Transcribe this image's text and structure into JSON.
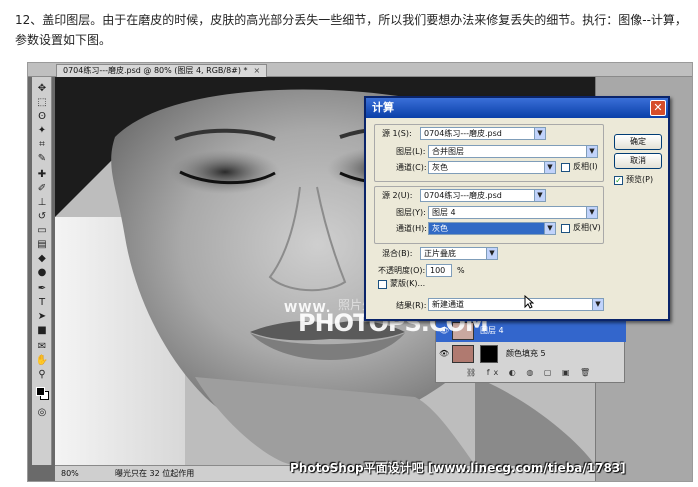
{
  "intro": {
    "text": "12、盖印图层。由于在磨皮的时候，皮肤的高光部分丢失一些细节，所以我们要想办法来修复丢失的细节。执行：图像--计算，参数设置如下图。"
  },
  "document": {
    "tab_title": "0704练习---磨皮.psd @ 80% (图层 4, RGB/8#) *",
    "tab_close": "×",
    "zoom": "80%",
    "status_info": "曝光只在 32 位起作用"
  },
  "dialog": {
    "title": "计算",
    "close": "✕",
    "source1": {
      "label": "源 1(S):",
      "file": "0704练习---磨皮.psd",
      "layer_label": "图层(L):",
      "layer": "合并图层",
      "channel_label": "通道(C):",
      "channel": "灰色",
      "invert_label": "反相(I)"
    },
    "source2": {
      "label": "源 2(U):",
      "file": "0704练习---磨皮.psd",
      "layer_label": "图层(Y):",
      "layer": "图层 4",
      "channel_label": "通道(H):",
      "channel": "灰色",
      "invert_label": "反相(V)"
    },
    "blending_label": "混合(B):",
    "blending": "正片叠底",
    "opacity_label": "不透明度(O):",
    "opacity": "100",
    "opacity_unit": "%",
    "mask_label": "蒙版(K)...",
    "result_label": "结果(R):",
    "result": "新建通道",
    "ok": "确定",
    "cancel": "取消",
    "preview_label": "预览(P)",
    "preview_checked": true
  },
  "layers": [
    {
      "name": "图层 4",
      "selected": true
    },
    {
      "name": "颜色填充 5",
      "selected": false
    }
  ],
  "watermark": {
    "small": "WWW.",
    "cn": "照片处理网",
    "big": "PHOTOPS.COM"
  },
  "footer": "PhotoShop平面设计吧 [www.linecg.com/tieba/1783]",
  "colors": {
    "dialog_title": "#0a3fa8",
    "highlight": "#316ac5",
    "dialog_bg": "#ece9d8"
  }
}
